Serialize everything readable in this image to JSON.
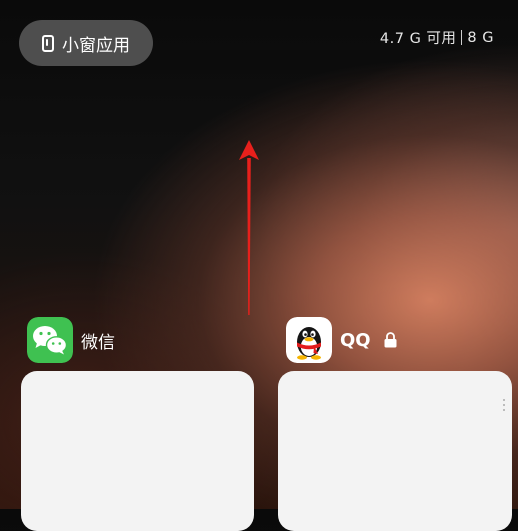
{
  "top_bar": {
    "small_window_label": "小窗应用",
    "small_window_icon": "small-window-icon",
    "memory_available": "4.7 G 可用",
    "memory_total": "8 G"
  },
  "annotation": {
    "arrow_color": "#e8201c",
    "direction": "up"
  },
  "recent_apps": [
    {
      "name": "微信",
      "icon": "wechat-icon",
      "icon_color": "#3fc151",
      "locked": false
    },
    {
      "name": "QQ",
      "icon": "qq-penguin-icon",
      "locked": true,
      "lock_icon": "lock-icon"
    }
  ]
}
